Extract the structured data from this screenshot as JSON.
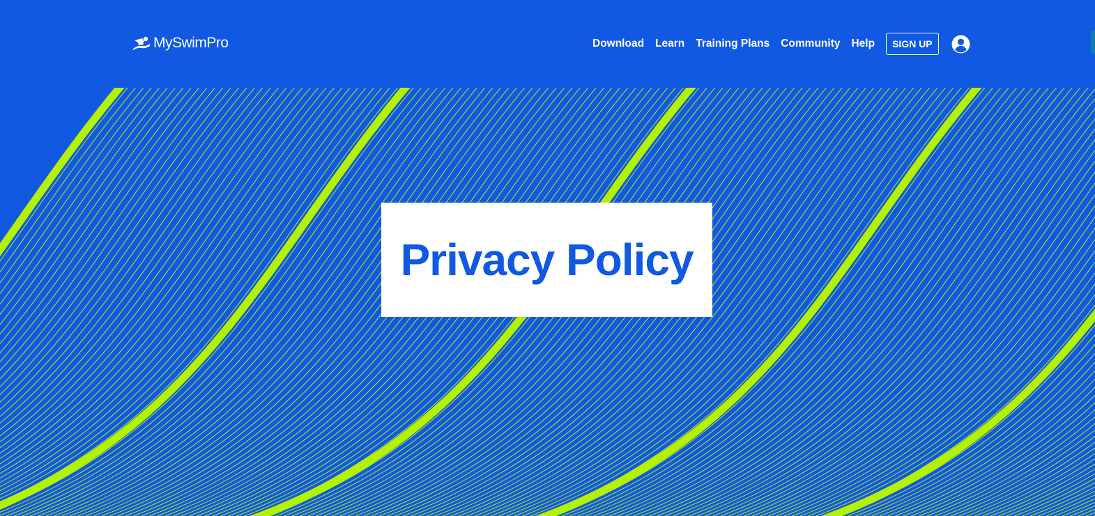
{
  "brand": {
    "name": "MySwimPro",
    "logo_icon": "swimmer-icon"
  },
  "nav": {
    "items": [
      {
        "label": "Download"
      },
      {
        "label": "Learn"
      },
      {
        "label": "Training Plans"
      },
      {
        "label": "Community"
      },
      {
        "label": "Help"
      }
    ],
    "signup_label": "SIGN UP",
    "account_icon": "account-circle-icon"
  },
  "hero": {
    "title": "Privacy Policy"
  },
  "colors": {
    "background": "#1159e3",
    "accent": "#b5f200",
    "text_on_background": "#ffffff",
    "title_text": "#1159e3",
    "title_box": "#ffffff"
  }
}
